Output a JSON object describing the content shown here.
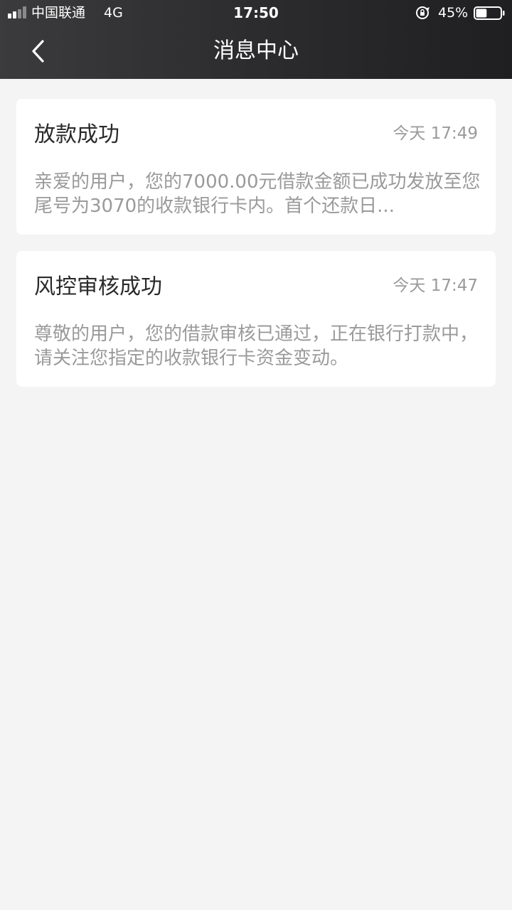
{
  "status_bar": {
    "carrier": "中国联通",
    "network": "4G",
    "time": "17:50",
    "battery": "45%",
    "signal_bars": 4,
    "signal_active": 2,
    "battery_level": 0.45
  },
  "header": {
    "title": "消息中心",
    "back_icon": "chevron-left-icon"
  },
  "colors": {
    "header_bg": "#2c2c2e",
    "page_bg": "#f4f4f4",
    "card_bg": "#ffffff",
    "title_text": "#2a2a2a",
    "muted_text": "#9a9a9a"
  },
  "messages": [
    {
      "title": "放款成功",
      "time": "今天 17:49",
      "body": "亲爱的用户，您的7000.00元借款金额已成功发放至您尾号为3070的收款银行卡内。首个还款日..."
    },
    {
      "title": "风控审核成功",
      "time": "今天 17:47",
      "body": "尊敬的用户，您的借款审核已通过，正在银行打款中，请关注您指定的收款银行卡资金变动。"
    }
  ]
}
